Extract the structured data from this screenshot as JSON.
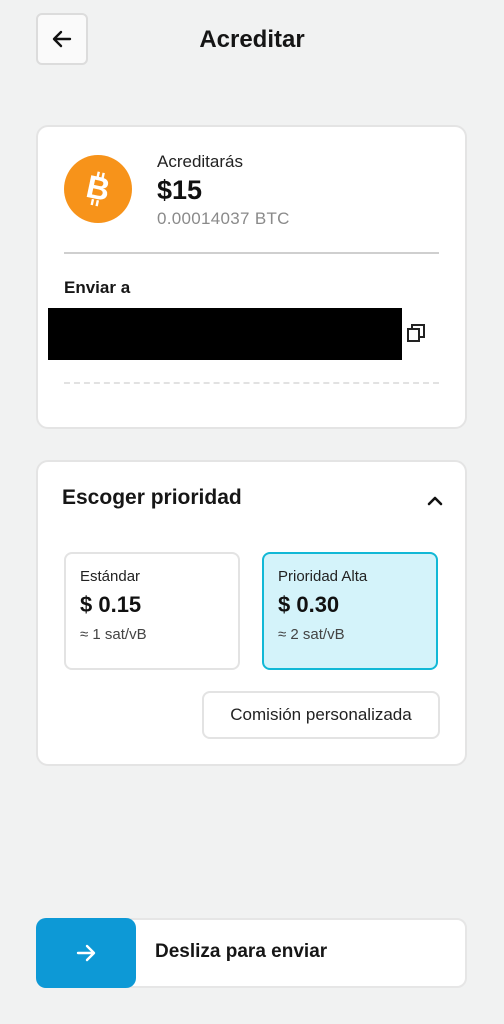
{
  "header": {
    "title": "Acreditar",
    "back_icon": "arrow-left-icon"
  },
  "summary": {
    "currency_icon": "bitcoin-icon",
    "brand_color": "#f7931a",
    "credit_label": "Acreditarás",
    "credit_amount": "$15",
    "credit_btc": "0.00014037 BTC",
    "send_to_label": "Enviar a",
    "address_redacted": true,
    "copy_icon": "copy-icon"
  },
  "priority": {
    "title": "Escoger prioridad",
    "expanded": true,
    "options": [
      {
        "name": "Estándar",
        "price": "$ 0.15",
        "rate": "≈ 1 sat/vB",
        "selected": false
      },
      {
        "name": "Prioridad Alta",
        "price": "$ 0.30",
        "rate": "≈ 2 sat/vB",
        "selected": true
      }
    ],
    "selected_color": "#12b8d6",
    "custom_fee_label": "Comisión personalizada"
  },
  "slider": {
    "label": "Desliza para enviar",
    "icon": "arrow-right-icon",
    "accent_color": "#0d99d6"
  }
}
